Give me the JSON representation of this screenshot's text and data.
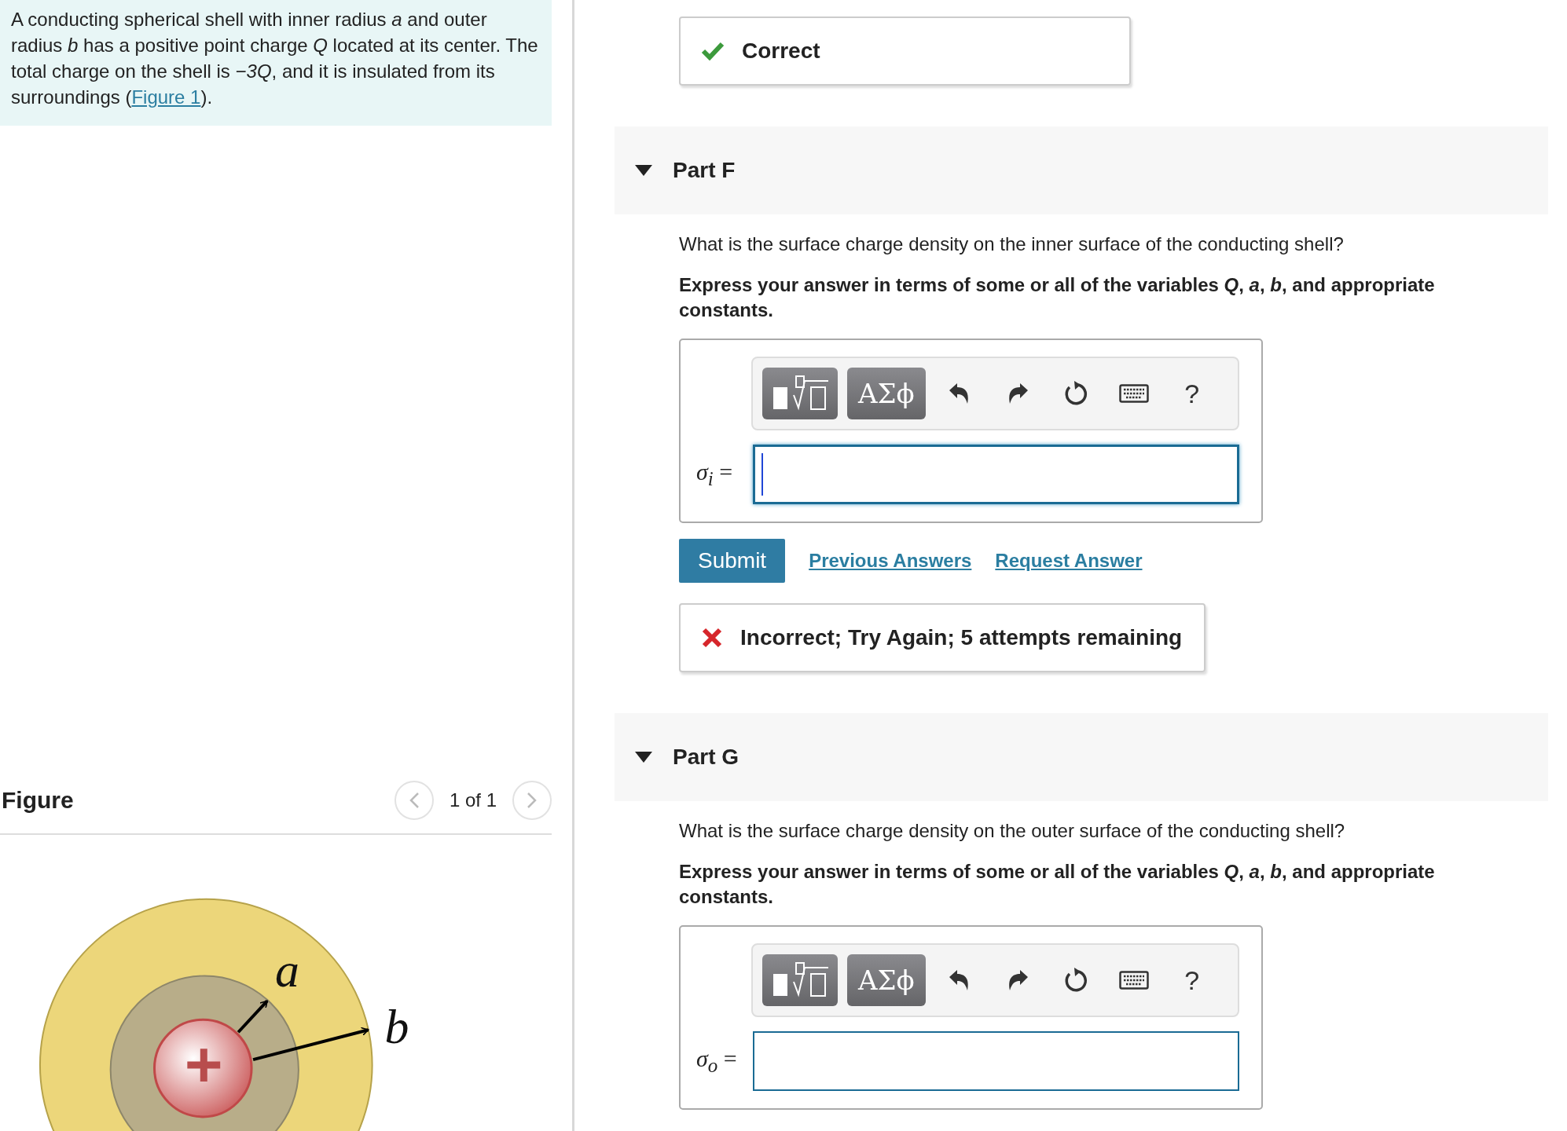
{
  "problem": {
    "text_before": "A conducting spherical shell with inner radius *a* and outer radius *b* has a positive point charge *Q* located at its center. The total charge on the shell is *−3Q*, and it is insulated from its surroundings (",
    "link": "Figure 1",
    "text_after": ")."
  },
  "figure": {
    "heading": "Figure",
    "pager": "1 of 1",
    "labels": [
      "a",
      "b"
    ]
  },
  "feedback_top": {
    "kind": "correct",
    "text": "Correct"
  },
  "parts": [
    {
      "title": "Part F",
      "expanded": true,
      "question": "What is the surface charge density on the inner surface of the conducting shell?",
      "instruction": "Express your answer in terms of some or all of the variables *Q*, *a*, *b*, and appropriate constants.",
      "toolbar": {
        "greek": "ΑΣϕ",
        "help": "?"
      },
      "label": "*σ*$_{i}$ =",
      "focused": true,
      "submit": "Submit",
      "links": [
        "Previous Answers",
        "Request Answer"
      ],
      "feedback": {
        "kind": "incorrect",
        "text": "Incorrect; Try Again; 5 attempts remaining"
      }
    },
    {
      "title": "Part G",
      "expanded": true,
      "question": "What is the surface charge density on the outer surface of the conducting shell?",
      "instruction": "Express your answer in terms of some or all of the variables *Q*, *a*, *b*, and appropriate constants.",
      "toolbar": {
        "greek": "ΑΣϕ",
        "help": "?"
      },
      "label": "*σ*$_{o}$ =",
      "focused": false
    }
  ]
}
